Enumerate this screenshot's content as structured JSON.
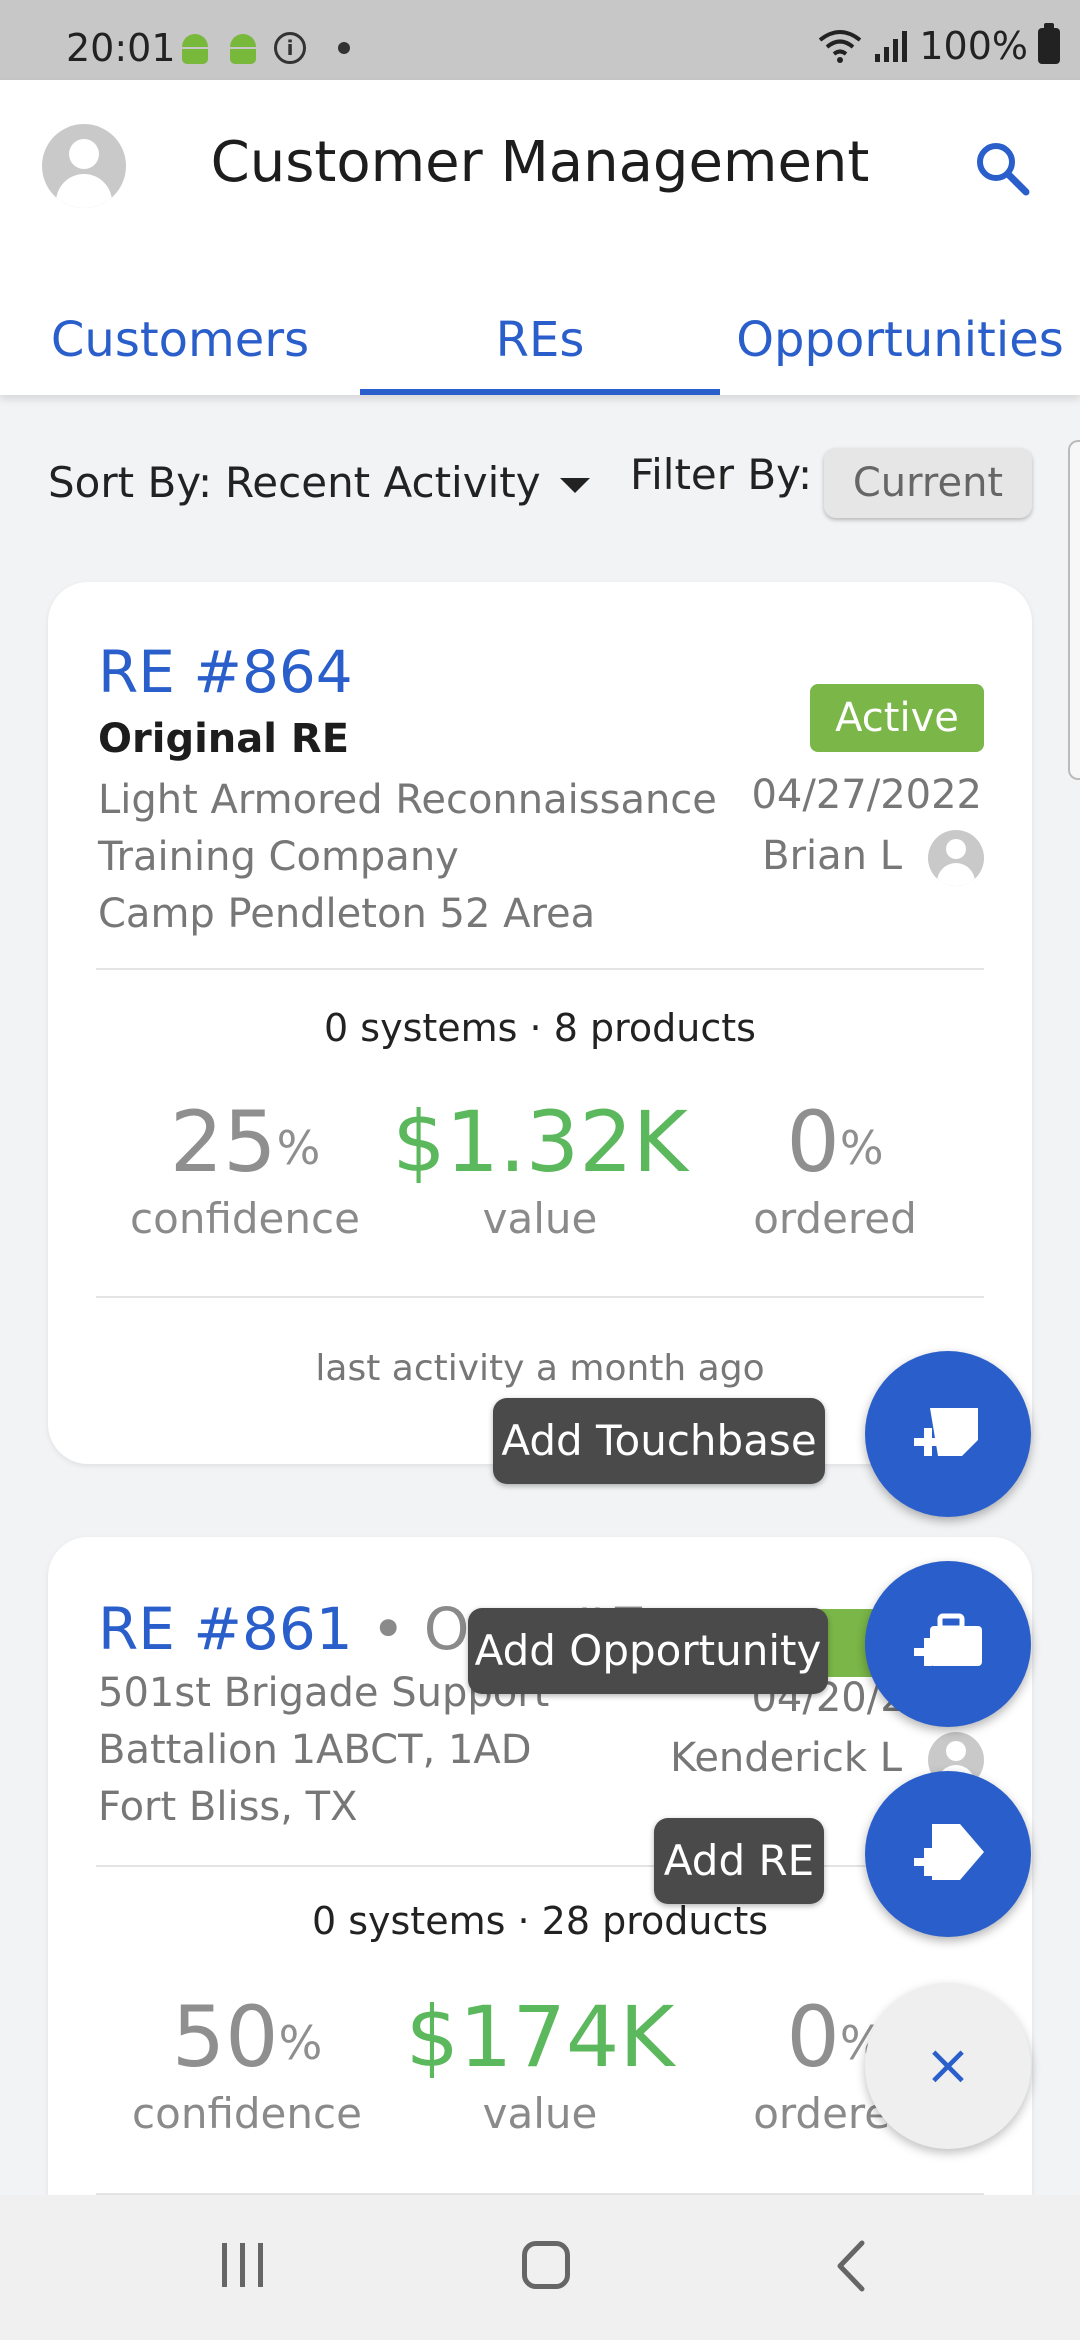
{
  "status_bar": {
    "time": "20:01",
    "battery": "100%",
    "icons": [
      "android-icon",
      "android-icon",
      "info-icon",
      "dot-icon",
      "wifi-icon",
      "signal-icon",
      "battery-icon"
    ]
  },
  "header": {
    "title": "Customer Management",
    "icons": [
      "avatar-icon",
      "search-icon"
    ]
  },
  "tabs": [
    {
      "label": "Customers",
      "active": false
    },
    {
      "label": "REs",
      "active": true
    },
    {
      "label": "Opportunities",
      "active": false
    }
  ],
  "sort": {
    "label": "Sort By:",
    "value": "Recent Activity",
    "filter_label": "Filter By:",
    "filter_value": "Current"
  },
  "cards": [
    {
      "id": "RE #864",
      "subtitle": "Original RE",
      "org_lines": [
        "Light Armored Reconnaissance",
        "Training Company",
        "Camp Pendleton 52 Area"
      ],
      "status": "Active",
      "date": "04/27/2022",
      "owner": "Brian L",
      "counts": "0 systems · 8 products",
      "confidence": "25",
      "confidence_unit": "%",
      "confidence_label": "confidence",
      "value": "$1.32K",
      "value_label": "value",
      "ordered": "0",
      "ordered_unit": "%",
      "ordered_label": "ordered",
      "last_activity": "last activity a month ago"
    },
    {
      "id": "RE #861",
      "opp": " • Opp #7",
      "org_lines": [
        "501st Brigade Support",
        "Battalion 1ABCT, 1AD",
        "Fort Bliss, TX"
      ],
      "status": "A",
      "date": "04/20/2022",
      "owner": "Kenderick L",
      "counts": "0 systems · 28 products",
      "confidence": "50",
      "confidence_unit": "%",
      "confidence_label": "confidence",
      "value": "$174K",
      "value_label": "value",
      "ordered": "0",
      "ordered_unit": "%",
      "ordered_label": "ordered"
    }
  ],
  "speed_dial": {
    "add_touchbase": "Add Touchbase",
    "add_opportunity": "Add Opportunity",
    "add_re": "Add RE",
    "close": "×"
  },
  "colors": {
    "primary": "#2a5fcb",
    "active_badge": "#7ab648",
    "value_green": "#5cb85c"
  }
}
